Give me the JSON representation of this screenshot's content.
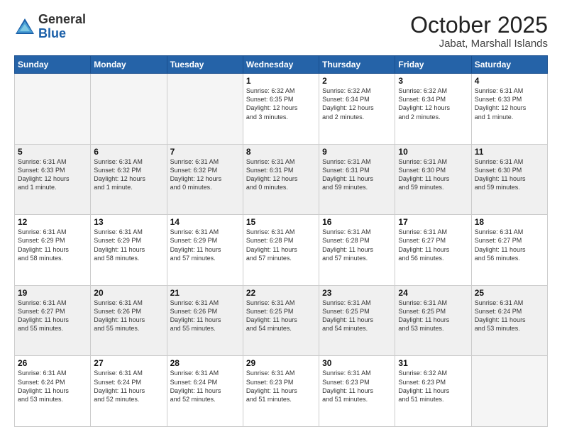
{
  "header": {
    "logo": {
      "general": "General",
      "blue": "Blue"
    },
    "month": "October 2025",
    "location": "Jabat, Marshall Islands"
  },
  "weekdays": [
    "Sunday",
    "Monday",
    "Tuesday",
    "Wednesday",
    "Thursday",
    "Friday",
    "Saturday"
  ],
  "weeks": [
    [
      {
        "day": "",
        "info": "",
        "empty": true
      },
      {
        "day": "",
        "info": "",
        "empty": true
      },
      {
        "day": "",
        "info": "",
        "empty": true
      },
      {
        "day": "1",
        "info": "Sunrise: 6:32 AM\nSunset: 6:35 PM\nDaylight: 12 hours\nand 3 minutes.",
        "empty": false
      },
      {
        "day": "2",
        "info": "Sunrise: 6:32 AM\nSunset: 6:34 PM\nDaylight: 12 hours\nand 2 minutes.",
        "empty": false
      },
      {
        "day": "3",
        "info": "Sunrise: 6:32 AM\nSunset: 6:34 PM\nDaylight: 12 hours\nand 2 minutes.",
        "empty": false
      },
      {
        "day": "4",
        "info": "Sunrise: 6:31 AM\nSunset: 6:33 PM\nDaylight: 12 hours\nand 1 minute.",
        "empty": false
      }
    ],
    [
      {
        "day": "5",
        "info": "Sunrise: 6:31 AM\nSunset: 6:33 PM\nDaylight: 12 hours\nand 1 minute.",
        "empty": false,
        "shaded": true
      },
      {
        "day": "6",
        "info": "Sunrise: 6:31 AM\nSunset: 6:32 PM\nDaylight: 12 hours\nand 1 minute.",
        "empty": false,
        "shaded": true
      },
      {
        "day": "7",
        "info": "Sunrise: 6:31 AM\nSunset: 6:32 PM\nDaylight: 12 hours\nand 0 minutes.",
        "empty": false,
        "shaded": true
      },
      {
        "day": "8",
        "info": "Sunrise: 6:31 AM\nSunset: 6:31 PM\nDaylight: 12 hours\nand 0 minutes.",
        "empty": false,
        "shaded": true
      },
      {
        "day": "9",
        "info": "Sunrise: 6:31 AM\nSunset: 6:31 PM\nDaylight: 11 hours\nand 59 minutes.",
        "empty": false,
        "shaded": true
      },
      {
        "day": "10",
        "info": "Sunrise: 6:31 AM\nSunset: 6:30 PM\nDaylight: 11 hours\nand 59 minutes.",
        "empty": false,
        "shaded": true
      },
      {
        "day": "11",
        "info": "Sunrise: 6:31 AM\nSunset: 6:30 PM\nDaylight: 11 hours\nand 59 minutes.",
        "empty": false,
        "shaded": true
      }
    ],
    [
      {
        "day": "12",
        "info": "Sunrise: 6:31 AM\nSunset: 6:29 PM\nDaylight: 11 hours\nand 58 minutes.",
        "empty": false
      },
      {
        "day": "13",
        "info": "Sunrise: 6:31 AM\nSunset: 6:29 PM\nDaylight: 11 hours\nand 58 minutes.",
        "empty": false
      },
      {
        "day": "14",
        "info": "Sunrise: 6:31 AM\nSunset: 6:29 PM\nDaylight: 11 hours\nand 57 minutes.",
        "empty": false
      },
      {
        "day": "15",
        "info": "Sunrise: 6:31 AM\nSunset: 6:28 PM\nDaylight: 11 hours\nand 57 minutes.",
        "empty": false
      },
      {
        "day": "16",
        "info": "Sunrise: 6:31 AM\nSunset: 6:28 PM\nDaylight: 11 hours\nand 57 minutes.",
        "empty": false
      },
      {
        "day": "17",
        "info": "Sunrise: 6:31 AM\nSunset: 6:27 PM\nDaylight: 11 hours\nand 56 minutes.",
        "empty": false
      },
      {
        "day": "18",
        "info": "Sunrise: 6:31 AM\nSunset: 6:27 PM\nDaylight: 11 hours\nand 56 minutes.",
        "empty": false
      }
    ],
    [
      {
        "day": "19",
        "info": "Sunrise: 6:31 AM\nSunset: 6:27 PM\nDaylight: 11 hours\nand 55 minutes.",
        "empty": false,
        "shaded": true
      },
      {
        "day": "20",
        "info": "Sunrise: 6:31 AM\nSunset: 6:26 PM\nDaylight: 11 hours\nand 55 minutes.",
        "empty": false,
        "shaded": true
      },
      {
        "day": "21",
        "info": "Sunrise: 6:31 AM\nSunset: 6:26 PM\nDaylight: 11 hours\nand 55 minutes.",
        "empty": false,
        "shaded": true
      },
      {
        "day": "22",
        "info": "Sunrise: 6:31 AM\nSunset: 6:25 PM\nDaylight: 11 hours\nand 54 minutes.",
        "empty": false,
        "shaded": true
      },
      {
        "day": "23",
        "info": "Sunrise: 6:31 AM\nSunset: 6:25 PM\nDaylight: 11 hours\nand 54 minutes.",
        "empty": false,
        "shaded": true
      },
      {
        "day": "24",
        "info": "Sunrise: 6:31 AM\nSunset: 6:25 PM\nDaylight: 11 hours\nand 53 minutes.",
        "empty": false,
        "shaded": true
      },
      {
        "day": "25",
        "info": "Sunrise: 6:31 AM\nSunset: 6:24 PM\nDaylight: 11 hours\nand 53 minutes.",
        "empty": false,
        "shaded": true
      }
    ],
    [
      {
        "day": "26",
        "info": "Sunrise: 6:31 AM\nSunset: 6:24 PM\nDaylight: 11 hours\nand 53 minutes.",
        "empty": false
      },
      {
        "day": "27",
        "info": "Sunrise: 6:31 AM\nSunset: 6:24 PM\nDaylight: 11 hours\nand 52 minutes.",
        "empty": false
      },
      {
        "day": "28",
        "info": "Sunrise: 6:31 AM\nSunset: 6:24 PM\nDaylight: 11 hours\nand 52 minutes.",
        "empty": false
      },
      {
        "day": "29",
        "info": "Sunrise: 6:31 AM\nSunset: 6:23 PM\nDaylight: 11 hours\nand 51 minutes.",
        "empty": false
      },
      {
        "day": "30",
        "info": "Sunrise: 6:31 AM\nSunset: 6:23 PM\nDaylight: 11 hours\nand 51 minutes.",
        "empty": false
      },
      {
        "day": "31",
        "info": "Sunrise: 6:32 AM\nSunset: 6:23 PM\nDaylight: 11 hours\nand 51 minutes.",
        "empty": false
      },
      {
        "day": "",
        "info": "",
        "empty": true
      }
    ]
  ]
}
